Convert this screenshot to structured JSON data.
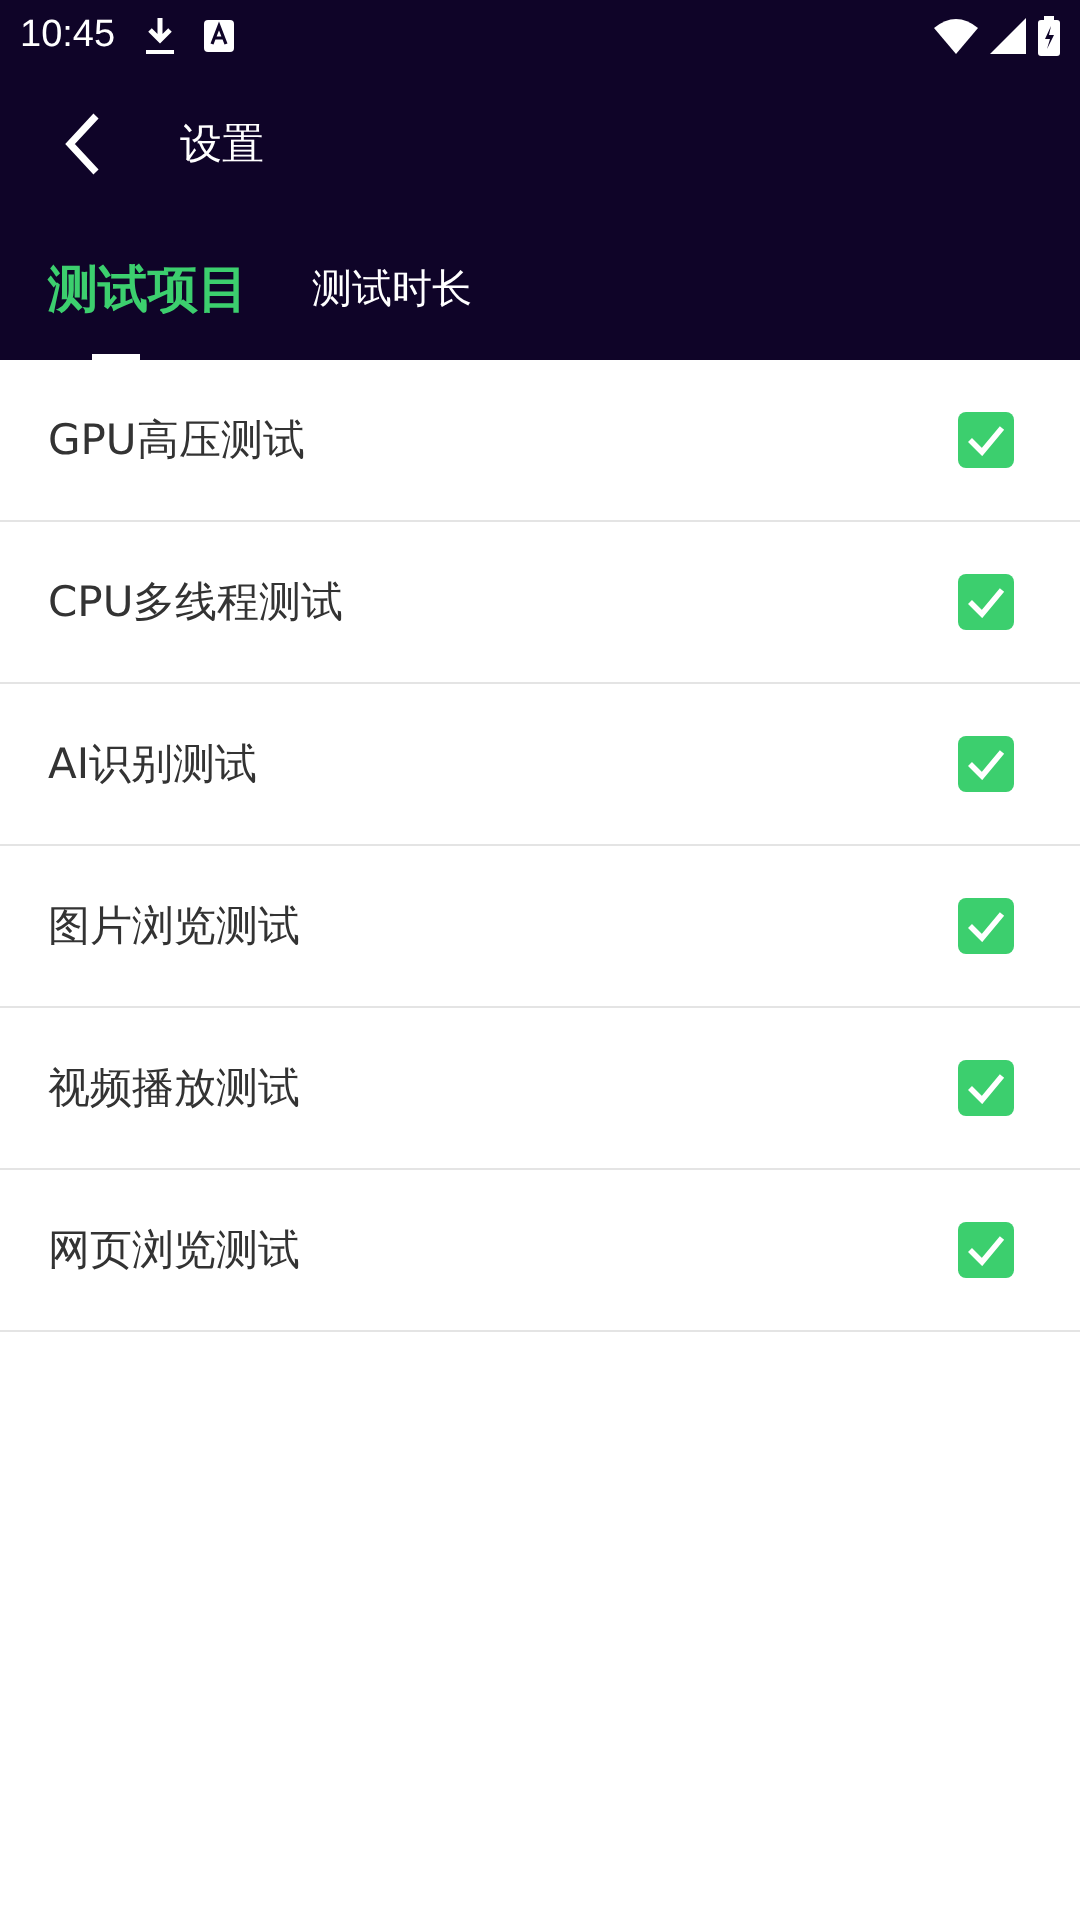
{
  "status_bar": {
    "time": "10:45"
  },
  "toolbar": {
    "title": "设置"
  },
  "tabs": [
    {
      "label": "测试项目",
      "selected": true
    },
    {
      "label": "测试时长",
      "selected": false
    }
  ],
  "items": [
    {
      "label": "GPU高压测试",
      "checked": true
    },
    {
      "label": "CPU多线程测试",
      "checked": true
    },
    {
      "label": "AI识别测试",
      "checked": true
    },
    {
      "label": "图片浏览测试",
      "checked": true
    },
    {
      "label": "视频播放测试",
      "checked": true
    },
    {
      "label": "网页浏览测试",
      "checked": true
    }
  ]
}
